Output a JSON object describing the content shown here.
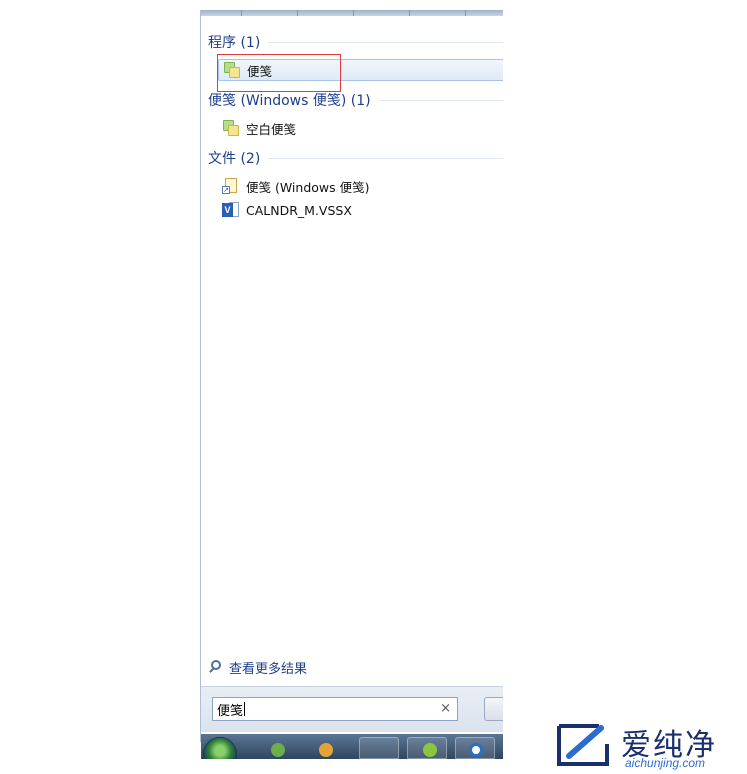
{
  "start_menu": {
    "groups": [
      {
        "title": "程序 (1)",
        "items": [
          {
            "label": "便笺",
            "icon": "sticky-notes-icon",
            "selected": true
          }
        ]
      },
      {
        "title": "便笺 (Windows 便笺) (1)",
        "items": [
          {
            "label": "空白便笺",
            "icon": "sticky-notes-icon",
            "selected": false
          }
        ]
      },
      {
        "title": "文件 (2)",
        "items": [
          {
            "label": "便笺 (Windows 便笺)",
            "icon": "shortcut-file-icon",
            "selected": false
          },
          {
            "label": "CALNDR_M.VSSX",
            "icon": "visio-file-icon",
            "selected": false
          }
        ]
      }
    ],
    "see_more": "查看更多结果",
    "search": {
      "value": "便笺",
      "clear_glyph": "×"
    }
  },
  "colors": {
    "group_title": "#1e3e8a",
    "highlight_border": "#e23b3b",
    "selection_border": "#a9c4e6",
    "logo_dark": "#1a2f6e",
    "logo_light": "#2c6ccf"
  },
  "watermark": {
    "brand_cn": "爱纯净",
    "brand_en": "aichunjing.com"
  }
}
